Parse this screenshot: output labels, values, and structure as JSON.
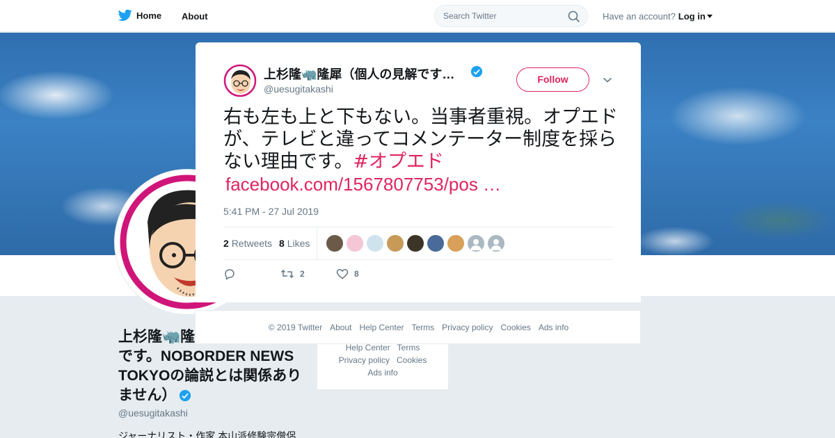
{
  "nav": {
    "home_label": "Home",
    "about_label": "About",
    "search_placeholder": "Search Twitter",
    "account_prompt": "Have an account?",
    "login_label": "Log in"
  },
  "profile": {
    "name": "上杉隆🦏隆犀（個人の見解です。NOBORDER NEWS TOKYOの論説とは関係ありません）",
    "handle": "@uesugitakashi",
    "bio": "ジャーナリスト・作家 本山派修験宗僧侶",
    "footer_links_row1": [
      "Help Center",
      "Terms"
    ],
    "footer_links_row2": [
      "Privacy policy",
      "Cookies"
    ],
    "footer_links_row3": "Ads info"
  },
  "tweet": {
    "display_name": "上杉隆🦏隆犀（個人の見解です…",
    "handle": "@uesugitakashi",
    "follow_label": "Follow",
    "text": "右も左も上と下もない。当事者重視。オプエドが、テレビと違ってコメンテーター制度を採らない理由です。",
    "hashtag": "#オプエド",
    "link": "facebook.com/1567807753/pos …",
    "timestamp": "5:41 PM - 27 Jul 2019",
    "retweets_count": "2",
    "retweets_label": "Retweets",
    "likes_count": "8",
    "likes_label": "Likes",
    "action_retweet_count": "2",
    "action_like_count": "8",
    "likers": [
      {
        "color": "#6b5a48"
      },
      {
        "color": "#f4c6d6"
      },
      {
        "color": "#cfe3ee"
      },
      {
        "color": "#c89a58"
      },
      {
        "color": "#3d3428"
      },
      {
        "color": "#4a6a9a"
      },
      {
        "color": "#d8a05a"
      },
      {
        "color": "#aab8c2"
      },
      {
        "color": "#aab8c2"
      }
    ]
  },
  "footer": {
    "links": [
      "© 2019 Twitter",
      "About",
      "Help Center",
      "Terms",
      "Privacy policy",
      "Cookies",
      "Ads info"
    ]
  },
  "colors": {
    "accent": "#e0245e",
    "verified": "#1da1f2",
    "muted": "#657786"
  }
}
